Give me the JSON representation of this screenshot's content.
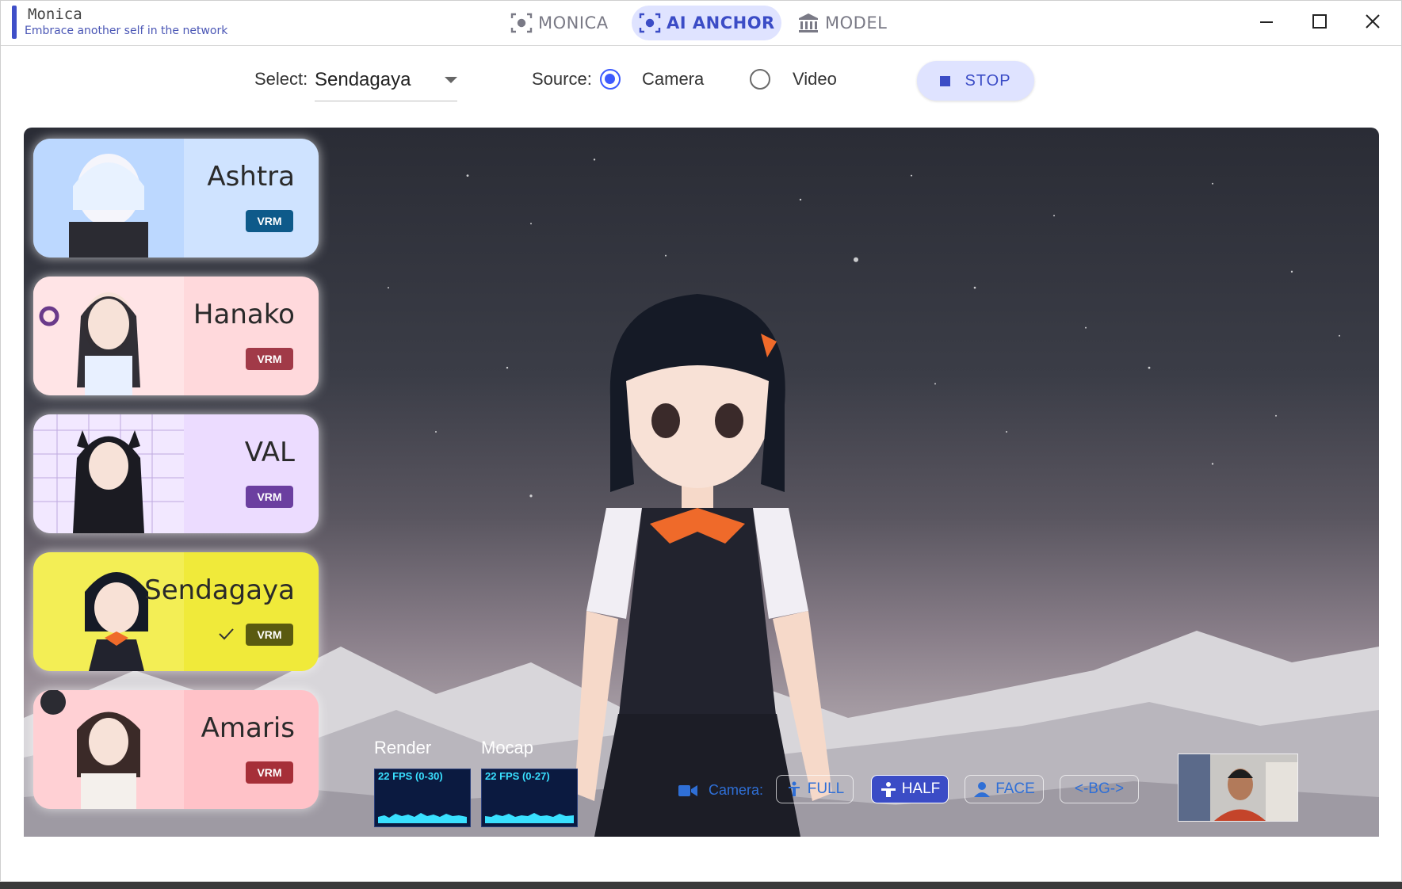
{
  "app": {
    "name": "Monica",
    "tagline": "Embrace another self in the network"
  },
  "nav": [
    {
      "label": "MONICA",
      "icon": "focus-frame-icon",
      "active": false
    },
    {
      "label": "AI ANCHOR",
      "icon": "focus-frame-icon",
      "active": true
    },
    {
      "label": "MODEL",
      "icon": "museum-icon",
      "active": false
    }
  ],
  "toolbar": {
    "select_label": "Select:",
    "select_value": "Sendagaya",
    "source_label": "Source:",
    "source_options": [
      "Camera",
      "Video"
    ],
    "source_selected": "Camera",
    "stop_label": "STOP"
  },
  "models": [
    {
      "name": "Ashtra",
      "badge": "VRM",
      "badge_color": "#0e5a8a",
      "bg": "#cfe3ff",
      "selected": false
    },
    {
      "name": "Hanako",
      "badge": "VRM",
      "badge_color": "#a13a48",
      "bg": "#ffd9dc",
      "selected": false
    },
    {
      "name": "VAL",
      "badge": "VRM",
      "badge_color": "#6b3fa0",
      "bg": "#ecdcff",
      "selected": false
    },
    {
      "name": "Sendagaya",
      "badge": "VRM",
      "badge_color": "#5a5a10",
      "bg": "#f0ea3a",
      "selected": true
    },
    {
      "name": "Amaris",
      "badge": "VRM",
      "badge_color": "#a62f38",
      "bg": "#ffc2c8",
      "selected": false
    }
  ],
  "stats": {
    "render_label": "Render",
    "render_fps": "22 FPS (0-30)",
    "mocap_label": "Mocap",
    "mocap_fps": "22 FPS (0-27)"
  },
  "camera": {
    "label": "Camera:",
    "modes": [
      "FULL",
      "HALF",
      "FACE",
      "<-BG->"
    ],
    "active_mode": "HALF"
  },
  "colors": {
    "accent": "#3b4cc6",
    "accent_light": "#dfe3ff",
    "radio": "#3d5afe"
  }
}
